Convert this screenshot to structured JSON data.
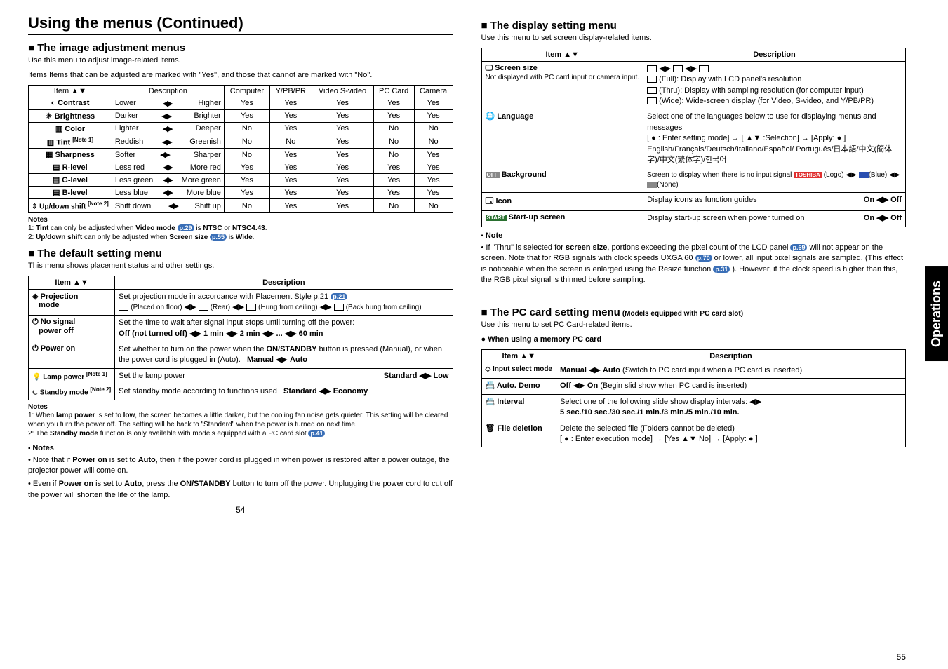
{
  "main_title": "Using the menus (Continued)",
  "left": {
    "image_adj": {
      "title": "The image adjustment menus",
      "intro1": "Use this menu to adjust image-related items.",
      "intro2": "Items Items that can be adjusted are marked with  \"Yes\", and those that cannot are marked with \"No\".",
      "head_item": "Item",
      "head_desc": "Description",
      "head_cols": [
        "Computer",
        "Y/PB/PR",
        "Video S-video",
        "PC Card",
        "Camera"
      ],
      "rows": [
        {
          "item": "Contrast",
          "left": "Lower",
          "right": "Higher",
          "vals": [
            "Yes",
            "Yes",
            "Yes",
            "Yes",
            "Yes"
          ]
        },
        {
          "item": "Brightness",
          "left": "Darker",
          "right": "Brighter",
          "vals": [
            "Yes",
            "Yes",
            "Yes",
            "Yes",
            "Yes"
          ]
        },
        {
          "item": "Color",
          "left": "Lighter",
          "right": "Deeper",
          "vals": [
            "No",
            "Yes",
            "Yes",
            "No",
            "No"
          ]
        },
        {
          "item": "Tint [Note 1]",
          "left": "Reddish",
          "right": "Greenish",
          "vals": [
            "No",
            "No",
            "Yes",
            "No",
            "No"
          ]
        },
        {
          "item": "Sharpness",
          "left": "Softer",
          "right": "Sharper",
          "vals": [
            "No",
            "Yes",
            "Yes",
            "No",
            "Yes"
          ]
        },
        {
          "item": "R-level",
          "left": "Less red",
          "right": "More red",
          "vals": [
            "Yes",
            "Yes",
            "Yes",
            "Yes",
            "Yes"
          ]
        },
        {
          "item": "G-level",
          "left": "Less green",
          "right": "More green",
          "vals": [
            "Yes",
            "Yes",
            "Yes",
            "Yes",
            "Yes"
          ]
        },
        {
          "item": "B-level",
          "left": "Less blue",
          "right": "More blue",
          "vals": [
            "Yes",
            "Yes",
            "Yes",
            "Yes",
            "Yes"
          ]
        },
        {
          "item": "Up/down shift [Note 2]",
          "left": "Shift down",
          "right": "Shift up",
          "vals": [
            "No",
            "Yes",
            "Yes",
            "No",
            "No"
          ]
        }
      ],
      "notes_title": "Notes",
      "note1": "1: Tint can only be adjusted when Video mode p.29  is NTSC or NTSC4.43.",
      "note2": "2: Up/down shift can only be adjusted when Screen size p.55  is Wide."
    },
    "default": {
      "title": "The default setting menu",
      "intro": "This menu shows placement status and other settings.",
      "head_item": "Item",
      "head_desc": "Description",
      "rows": [
        {
          "item": "Projection mode",
          "desc_line1": "Set projection mode in accordance with Placement Style p.21",
          "opts": [
            "(Placed on floor)",
            "(Rear)",
            "(Hung from ceiling)",
            "(Back hung from ceiling)"
          ]
        },
        {
          "item": "No signal power off",
          "desc": "Set the time to wait after signal input stops until turning off the power:",
          "opts_line": "Off (not turned off) ◀▶ 1 min ◀▶ 2 min ◀▶ ... ◀▶ 60 min"
        },
        {
          "item": "Power on",
          "desc": "Set whether to turn on the power when the ON/STANDBY button is pressed (Manual), or when the power cord is plugged in (Auto).  Manual ◀▶ Auto"
        },
        {
          "item": "Lamp power [Note 1]",
          "desc": "Set the lamp power",
          "right": "Standard ◀▶ Low"
        },
        {
          "item": "Standby mode [Note 2]",
          "desc": "Set standby mode according to functions used  Standard ◀▶ Economy"
        }
      ],
      "notes_title": "Notes",
      "note1": "1: When lamp power is set to low, the screen becomes a little darker, but the cooling fan noise gets quieter. This setting will be cleared when you turn the power off. The setting will be back to \"Standard\" when the power is turned on next time.",
      "note2": "2: The Standby mode function is only available with models equipped with a PC card slot p.41 .",
      "notes2_title": "Notes",
      "bullets": [
        "Note that if Power on is set to Auto, then if the power cord is plugged in when power is restored after a power outage, the projector power will come on.",
        "Even if Power on is set to Auto, press the ON/STANDBY button to turn off the power. Unplugging the power cord to cut off the power will shorten the life of the lamp."
      ]
    },
    "pagenum": "54"
  },
  "right": {
    "display": {
      "title": "The display setting menu",
      "intro": "Use this menu to set screen display-related items.",
      "head_item": "Item",
      "head_desc": "Description",
      "rows": [
        {
          "item": "Screen size",
          "sub": "Not displayed with PC card input or camera input.",
          "lines": [
            "(Full):  Display with LCD panel's resolution",
            "(Thru): Display with sampling resolution (for computer input)",
            "(Wide):  Wide-screen display (for Video, S-video, and Y/PB/PR)"
          ]
        },
        {
          "item": "Language",
          "desc": "Select one of the languages below to use for displaying menus and messages",
          "flow": "[ ● : Enter setting mode] → [ ▲▼ :Selection] → [Apply: ● ]",
          "langs": "English/Français/Deutsch/Italiano/Español/ Português/日本語/中文(簡体字)/中文(繁体字)/한국어"
        },
        {
          "item": "Background",
          "desc": "Screen to display when there is no input signal",
          "opts": "TOSHIBA (Logo) ◀▶ (Blue) ◀▶ (None)"
        },
        {
          "item": "Icon",
          "desc": "Display icons as function guides",
          "right": "On ◀▶ Off"
        },
        {
          "item": "Start-up screen",
          "desc": "Display start-up screen when power turned on",
          "right": "On ◀▶ Off"
        }
      ],
      "note_title": "Note",
      "note": "If \"Thru\" is selected for screen size, portions exceeding the pixel count of the LCD panel p.69  will not appear on the screen. Note that for RGB signals with clock speeds UXGA 60 p.70  or lower, all input pixel signals are sampled. (This effect is noticeable when the screen is enlarged using the Resize function p.31 ). However, if the clock speed is higher than this, the RGB pixel signal is thinned before sampling."
    },
    "pccard": {
      "title": "The PC card setting menu",
      "subtitle": "(Models equipped with PC card slot)",
      "intro": "Use this menu to set PC Card-related items.",
      "subhead": "● When using a memory PC card",
      "head_item": "Item",
      "head_desc": "Description",
      "rows": [
        {
          "item": "Input select mode",
          "desc": "Manual ◀▶ Auto (Switch to PC card input when a PC card is inserted)"
        },
        {
          "item": "Auto. Demo",
          "desc": "Off ◀▶ On (Begin slid show when PC card is inserted)"
        },
        {
          "item": "Interval",
          "desc": "Select one of the following slide show display intervals:  ◀▶",
          "line2": "5 sec./10 sec./30 sec./1 min./3 min./5 min./10 min."
        },
        {
          "item": "File deletion",
          "desc": "Delete the selected file (Folders cannot be deleted)",
          "line2": "[ ● : Enter execution mode] → [Yes ▲▼ No] → [Apply: ● ]"
        }
      ]
    },
    "side_tab": "Operations",
    "pagenum": "55"
  }
}
